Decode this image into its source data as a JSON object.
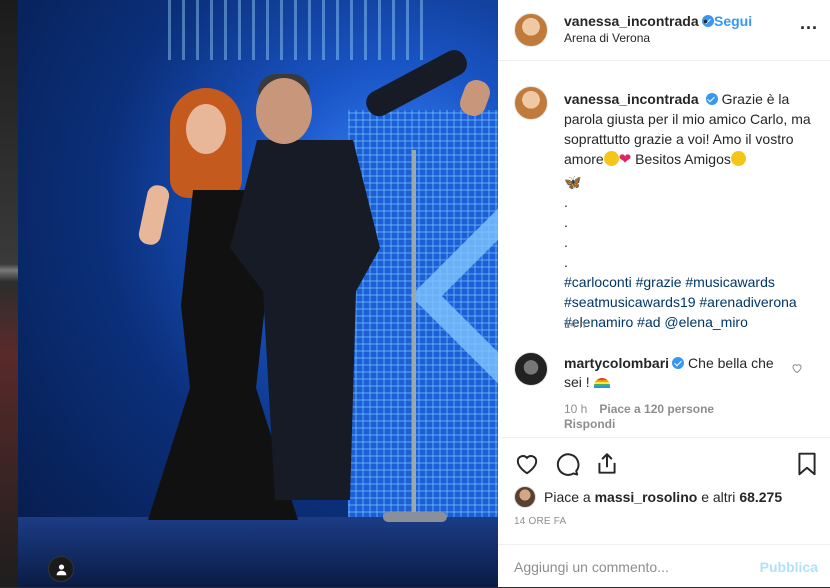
{
  "post": {
    "username": "vanessa_incontrada",
    "separator": "•",
    "follow_label": "Segui",
    "location": "Arena di Verona",
    "more_label": "..."
  },
  "caption": {
    "username": "vanessa_incontrada",
    "text_1": "Grazie è la parola giusta per il mio amico Carlo, ma soprattutto grazie a voi! Amo il vostro amore",
    "text_2": " Besitos Amigos",
    "dots": [
      ".",
      ".",
      ".",
      "."
    ],
    "hashtags": "#carloconti #grazie #musicawards #seatmusicawards19 #arenadiverona #elenamiro #ad @elena_miro",
    "time": "14 h"
  },
  "comment": {
    "username": "martycolombari",
    "text": "Che bella che sei !",
    "time": "10 h",
    "likes": "Piace a 120 persone",
    "reply": "Rispondi"
  },
  "likes": {
    "prefix": "Piace a ",
    "user": "massi_rosolino",
    "middle": " e altri ",
    "count": "68.275"
  },
  "when": "14 ORE FA",
  "add_comment": {
    "placeholder": "Aggiungi un commento...",
    "publish": "Pubblica"
  },
  "colors": {
    "accent": "#3897f0",
    "hashtag": "#003569",
    "muted": "#8e8e8e",
    "publish_disabled": "#b2dffc"
  },
  "icons": [
    "heart-icon",
    "comment-icon",
    "share-icon",
    "bookmark-icon",
    "verified-icon",
    "more-icon",
    "user-tag-icon"
  ]
}
